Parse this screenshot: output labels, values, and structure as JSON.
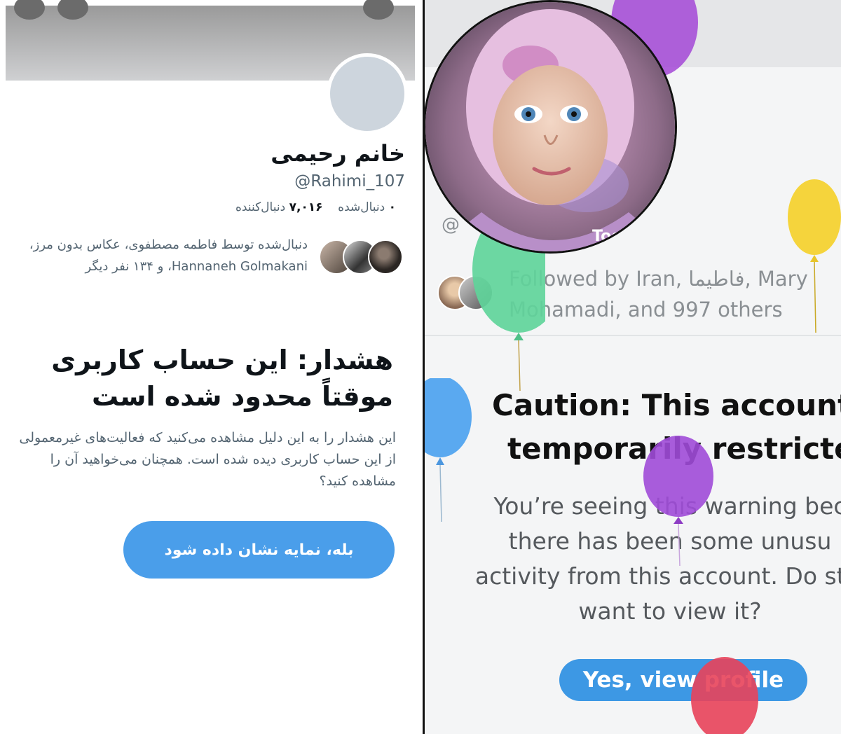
{
  "left": {
    "name": "خانم رحیمی",
    "handle": "@Rahimi_107",
    "following_count": "۰",
    "following_label": "دنبال‌شده",
    "followers_count": "۷,۰۱۶",
    "followers_label": "دنبال‌کننده",
    "followed_by": "دنبال‌شده توسط فاطمه مصطفوی، عکاس بدون مرز، Hannaneh Golmakani، و ۱۳۴ نفر دیگر",
    "warning_title": "هشدار: این حساب کاربری موقتاً محدود شده است",
    "warning_body": "این هشدار را به این دلیل مشاهده می‌کنید که فعالیت‌های غیرمعمولی از این حساب کاربری دیده شده است. همچنان می‌خواهید آن را مشاهده کنید؟",
    "view_button": "بله، نمایه نشان داده شود"
  },
  "right": {
    "handle_partial": "@",
    "followed_by": "Followed by Iran, فاطیما, Mary Mohamadi, and 997 others",
    "warning_title_line1": "Caution: This account",
    "warning_title_line2": "temporarily restricte",
    "warning_body": "You’re seeing this warning bec there has been some unusu activity from this account. Do still want to view it?",
    "view_button": "Yes, view profile",
    "avatar_watermark": "Too"
  },
  "colors": {
    "accent": "#4a9eea",
    "text_primary": "#0f1419",
    "text_secondary": "#536471"
  }
}
